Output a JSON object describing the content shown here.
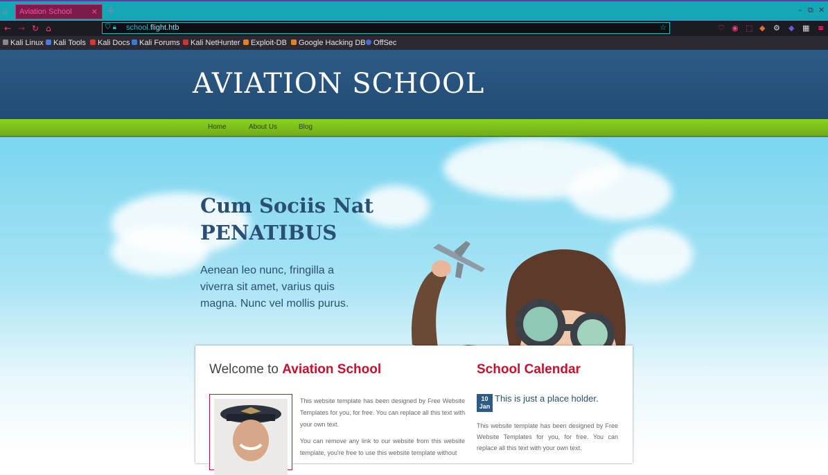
{
  "browser": {
    "tab_title": "Aviation School",
    "tab_close": "×",
    "new_tab": "+",
    "url_prefix": "school.",
    "url_host": "flight.htb",
    "win_minimize": "–",
    "win_restore": "⧉",
    "win_close": "✕",
    "bookmarks": [
      "Kali Linux",
      "Kali Tools",
      "Kali Docs",
      "Kali Forums",
      "Kali NetHunter",
      "Exploit-DB",
      "Google Hacking DB",
      "OffSec"
    ]
  },
  "site": {
    "logo": "AVIATION SCHOOL",
    "nav": [
      "Home",
      "About Us",
      "Blog"
    ]
  },
  "hero": {
    "heading_line1": "Cum Sociis Nat",
    "heading_line2": "PENATIBUS",
    "text": "Aenean leo nunc, fringilla a viverra sit amet, varius quis magna. Nunc vel mollis purus."
  },
  "welcome": {
    "prefix": "Welcome to ",
    "highlight": "Aviation School",
    "para1": "This website template has been designed by Free Website Templates for you, for free. You can replace all this text with your own text.",
    "para2": "You can remove any link to our website from this website template, you're free to use this website template without"
  },
  "calendar": {
    "title": "School Calendar",
    "day": "10",
    "month": "Jan",
    "event": "This is just a place holder.",
    "text": "This website template has been designed by Free Website Templates for you, for free. You can replace all this text with your own text."
  }
}
